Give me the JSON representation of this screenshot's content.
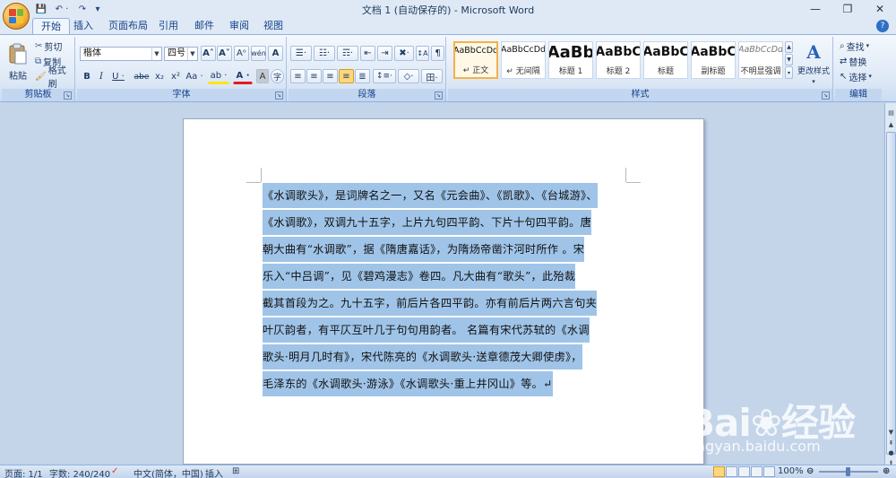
{
  "window": {
    "title": "文档 1 (自动保存的) - Microsoft Word",
    "controls": [
      "—",
      "❐",
      "✕"
    ]
  },
  "qat": {
    "save": "💾",
    "undo": "↶ ·",
    "redo": "↷",
    "customize": "▾"
  },
  "tabs": [
    "开始",
    "插入",
    "页面布局",
    "引用",
    "邮件",
    "审阅",
    "视图"
  ],
  "ribbon": {
    "clipboard": {
      "label": "剪贴板",
      "paste": "粘贴",
      "cut": "剪切",
      "copy": "复制",
      "format_painter": "格式刷"
    },
    "font": {
      "label": "字体",
      "font_name": "楷体",
      "font_size": "四号",
      "grow": "A˄",
      "shrink": "A˅",
      "clear": "Aᵒ",
      "phonetic": "wén",
      "border_a": "A",
      "bold": "B",
      "italic": "I",
      "underline": "U ·",
      "strike": "abe",
      "subscript": "x₂",
      "superscript": "x²",
      "case": "Aa ·",
      "highlight": "ab ·",
      "color": "A ·",
      "shading": "A",
      "enclose": "字"
    },
    "paragraph": {
      "label": "段落",
      "bullets": "☰·",
      "numbering": "☷·",
      "multilevel": "☶·",
      "decrease_indent": "⇤",
      "increase_indent": "⇥",
      "chinese_layout": "✖·",
      "sort": "↕A",
      "show_marks": "¶",
      "align_left": "≡",
      "center": "≡",
      "align_right": "≡",
      "justify": "≡",
      "distributed": "≣",
      "line_spacing": "↕≡·",
      "para_shading": "◇·",
      "borders": "田·"
    },
    "styles": {
      "label": "样式",
      "items": [
        {
          "sample": "AaBbCcDd",
          "name": "↵ 正文"
        },
        {
          "sample": "AaBbCcDd",
          "name": "↵ 无间隔"
        },
        {
          "sample": "AaBb",
          "name": "标题 1"
        },
        {
          "sample": "AaBbC",
          "name": "标题 2"
        },
        {
          "sample": "AaBbC",
          "name": "标题"
        },
        {
          "sample": "AaBbC",
          "name": "副标题"
        },
        {
          "sample": "AaBbCcDd",
          "name": "不明显强调"
        }
      ],
      "change_styles": "更改样式"
    },
    "editing": {
      "label": "编辑",
      "find": "查找",
      "replace": "替换",
      "select": "选择"
    }
  },
  "document": {
    "lines": [
      "《水调歌头》，是词牌名之一，又名《元会曲》、《凯歌》、《台城游》、",
      "《水调歌》，双调九十五字，上片九句四平韵、下片十句四平韵。唐",
      "朝大曲有“水调歌”，据《隋唐嘉话》，为隋炀帝凿汴河时所作 。宋",
      "乐入“中吕调”，见《碧鸡漫志》卷四。凡大曲有“歌头”，此殆裁",
      "截其首段为之。九十五字，前后片各四平韵。亦有前后片两六言句夹",
      "叶仄韵者，有平仄互叶几于句句用韵者。 名篇有宋代苏轼的《水调",
      "歌头·明月几时有》，宋代陈亮的《水调歌头·送章德茂大卿使虏》，",
      "毛泽东的《水调歌头·游泳》《水调歌头·重上井冈山》等。↵"
    ]
  },
  "status": {
    "page": "页面: 1/1",
    "words": "字数: 240/240",
    "language": "中文(简体，中国)",
    "mode": "插入",
    "zoom": "100%"
  },
  "watermark": {
    "brand": "Bai❀经验",
    "url": "jingyan.baidu.com"
  }
}
